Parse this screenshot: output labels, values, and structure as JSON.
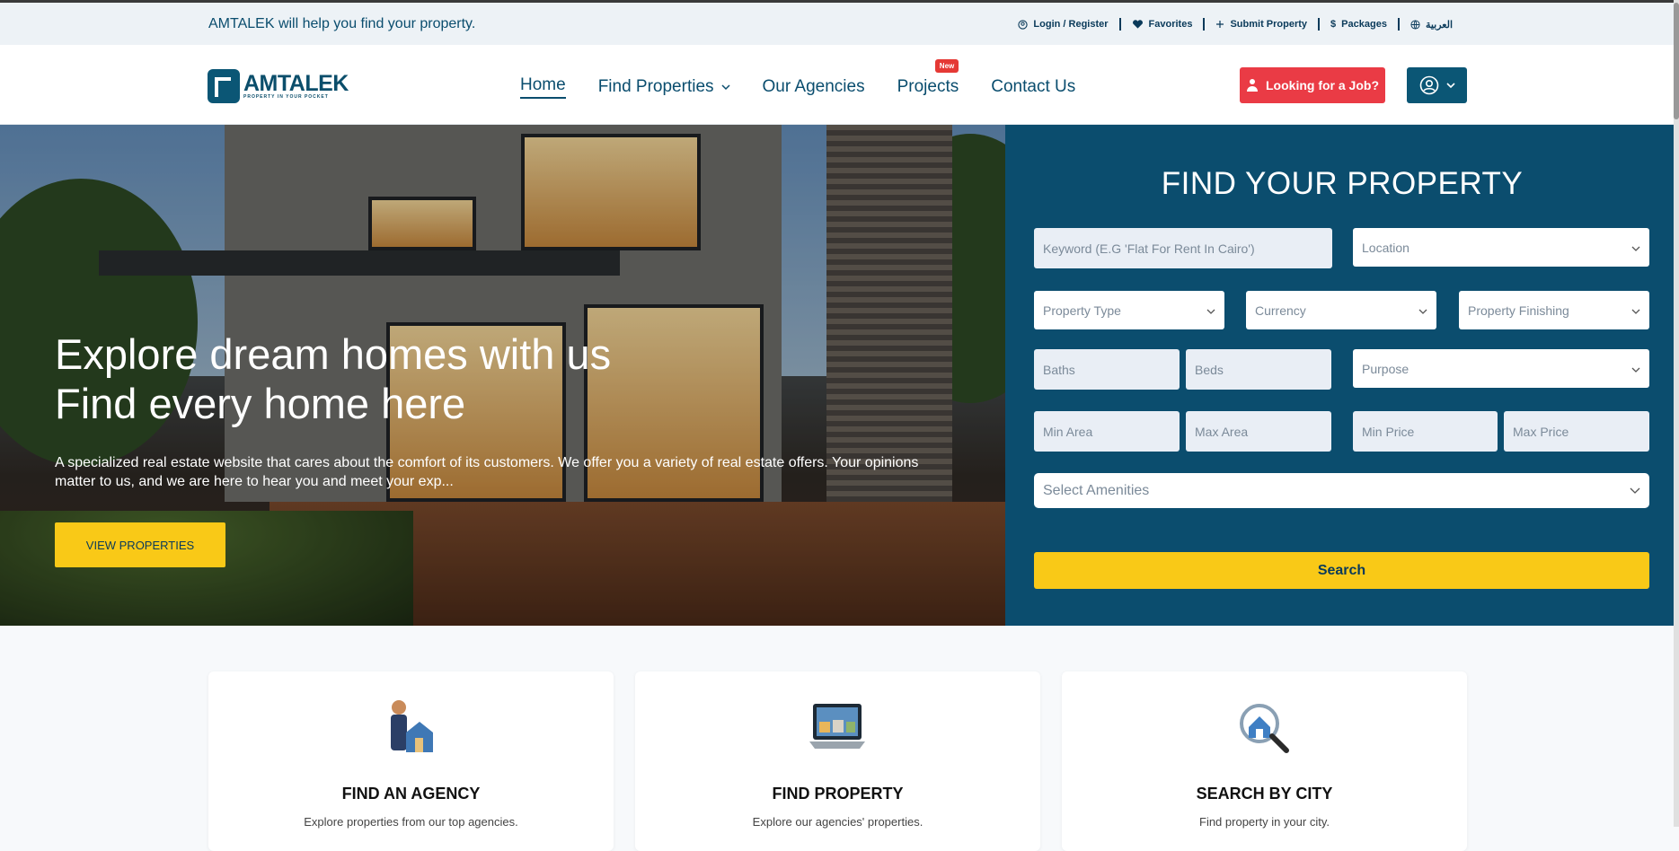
{
  "topbar": {
    "tagline": "AMTALEK will help you find your property.",
    "links": {
      "login": "Login / Register",
      "favorites": "Favorites",
      "submit": "Submit Property",
      "packages": "Packages",
      "language": "العربية"
    }
  },
  "brand": {
    "name": "AMTALEK",
    "sub": "PROPERTY IN YOUR POCKET"
  },
  "nav": {
    "home": "Home",
    "find": "Find Properties",
    "agencies": "Our Agencies",
    "projects": "Projects",
    "projects_badge": "New",
    "contact": "Contact Us",
    "job_button": "Looking for a Job?"
  },
  "hero": {
    "line1": "Explore dream homes with us",
    "line2": "Find every home here",
    "text": "A specialized real estate website that cares about the comfort of its customers. We offer you a variety of real estate offers. Your opinions matter to us, and we are here to hear you and meet your exp...",
    "button": "VIEW PROPERTIES"
  },
  "search": {
    "title": "FIND YOUR PROPERTY",
    "keyword": "Keyword (E.G 'Flat For Rent In Cairo')",
    "location": "Location",
    "property_type": "Property Type",
    "currency": "Currency",
    "finishing": "Property Finishing",
    "baths": "Baths",
    "beds": "Beds",
    "purpose": "Purpose",
    "min_area": "Min Area",
    "max_area": "Max Area",
    "min_price": "Min Price",
    "max_price": "Max Price",
    "amenities": "Select Amenities",
    "button": "Search"
  },
  "cards": [
    {
      "title": "FIND AN AGENCY",
      "desc": "Explore properties from our top agencies."
    },
    {
      "title": "FIND PROPERTY",
      "desc": "Explore our agencies' properties."
    },
    {
      "title": "SEARCH BY CITY",
      "desc": "Find property in your city."
    }
  ],
  "colors": {
    "primary": "#0b4d6e",
    "accent": "#f9c917",
    "danger": "#ea3b45"
  }
}
